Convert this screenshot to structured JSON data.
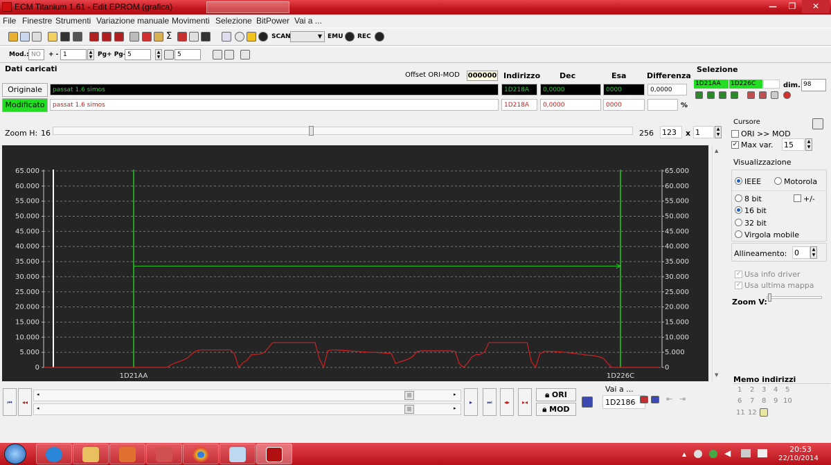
{
  "window": {
    "title": "ECM Titanium 1.61 - Edit EPROM (grafica)",
    "ghost_tabs": [
      "",
      ""
    ],
    "controls": {
      "minimize": "—",
      "restore": "❐",
      "close": "✕"
    }
  },
  "menu": [
    "File",
    "Finestre",
    "Strumenti",
    "Variazione manuale",
    "Movimenti",
    "Selezione",
    "BitPower",
    "Vai a ..."
  ],
  "toolbar1": {
    "scan_label": "SCAN",
    "emu_label": "EMU",
    "rec_label": "REC"
  },
  "toolbar2": {
    "mod_label": "Mod.:",
    "mod_value": "NO",
    "plusminus_label": "+ -",
    "plusminus_value": "1",
    "pg_label": "Pg+ Pg-",
    "pg_value": "5",
    "cols_value": "5"
  },
  "dati": {
    "section_label": "Dati caricati",
    "offset_label": "Offset ORI-MOD",
    "offset_value": "000000",
    "col_indirizzo": "Indirizzo",
    "col_dec": "Dec",
    "col_esa": "Esa",
    "col_differenza": "Differenza",
    "originale_button": "Originale",
    "modificato_button": "Modificato",
    "orig_name": "passat 1.6 simos",
    "mod_name": "passat 1.6 simos",
    "orig_indirizzo": "1D218A",
    "orig_dec": "0,0000",
    "orig_esa": "0000",
    "orig_diff": "0,0000",
    "mod_indirizzo": "1D218A",
    "mod_dec": "0,0000",
    "mod_esa": "0000",
    "mod_diff": "",
    "percent": "%"
  },
  "selezione": {
    "label": "Selezione",
    "start": "1D21AA",
    "end": "1D226C",
    "dim_label": "dim.",
    "dim_value": "98"
  },
  "zoom_h": {
    "label": "Zoom H:",
    "min": "16",
    "max": "256",
    "value": "123",
    "times": "x",
    "multiplier": "1",
    "slider_fraction": 0.445
  },
  "cursore": {
    "label": "Cursore",
    "ori_mod_label": "ORI >> MOD",
    "ori_mod_checked": false,
    "maxvar_label": "Max var.",
    "maxvar_checked": true,
    "maxvar_value": "15"
  },
  "visualizzazione": {
    "label": "Visualizzazione",
    "ieee": "IEEE",
    "motorola": "Motorola",
    "bit8": "8 bit",
    "bit16": "16 bit",
    "bit32": "32 bit",
    "virgola": "Virgola mobile",
    "plusminus": "+/-",
    "allineamento_label": "Allineamento:",
    "allineamento_value": "0",
    "usa_info": "Usa info driver",
    "usa_mappa": "Usa ultima mappa",
    "zoom_v": "Zoom V:"
  },
  "memo": {
    "label": "Memo indirizzi",
    "numbers": [
      "1",
      "2",
      "3",
      "4",
      "5",
      "6",
      "7",
      "8",
      "9",
      "10",
      "11",
      "12"
    ]
  },
  "bottom": {
    "ori_button": "ORI",
    "mod_button": "MOD",
    "vai_label": "Vai a ...",
    "vai_value": "1D2186"
  },
  "taskbar": {
    "time": "20:53",
    "date": "22/10/2014"
  },
  "colors": {
    "chart_bg": "#252525",
    "series_ori": "#d42020",
    "marker": "#22cc22",
    "selection_green": "#22dd22",
    "titlebar_red": "#c1151c"
  },
  "chart_data": {
    "type": "line",
    "y_ticks": [
      "65.000",
      "60.000",
      "55.000",
      "50.000",
      "45.000",
      "40.000",
      "35.000",
      "30.000",
      "25.000",
      "20.000",
      "15.000",
      "10.000",
      "5.000",
      "0"
    ],
    "ylim": [
      0,
      65000
    ],
    "x_labels": [
      "1D21AA",
      "1D226C"
    ],
    "cursor_value": 33500,
    "grid": true,
    "series": [
      {
        "values": [
          0,
          0,
          0,
          0,
          0,
          0,
          0,
          0,
          0,
          0,
          0,
          0,
          0,
          0,
          0,
          0,
          0,
          0,
          0,
          0,
          0,
          0,
          0,
          0,
          0,
          0,
          0,
          0,
          0,
          0,
          800,
          1500,
          2000,
          2500,
          3200,
          4500,
          5500,
          5800,
          5800,
          5800,
          5800,
          5800,
          5800,
          5800,
          5800,
          4500,
          0,
          1500,
          2500,
          4200,
          4300,
          4400,
          5000,
          6500,
          8200,
          8200,
          8200,
          8200,
          8200,
          8200,
          8200,
          8200,
          8200,
          8200,
          8200,
          3000,
          0,
          5500,
          5800,
          5800,
          5700,
          5600,
          5500,
          5400,
          5300,
          5200,
          5100,
          5000,
          5000,
          4900,
          4800,
          4700,
          4600,
          1300,
          1800,
          2300,
          2800,
          3600,
          5200,
          5500,
          5500,
          5500,
          5500,
          5500,
          5500,
          5500,
          5500,
          5300,
          1300,
          0,
          1500,
          3500,
          4200,
          4300,
          5200,
          8200,
          8200,
          8200,
          8200,
          8200,
          8200,
          8200,
          8200,
          8200,
          8200,
          2000,
          0,
          4500,
          5300,
          5300,
          5300,
          5200,
          5100,
          5000,
          4800,
          4700,
          4500,
          4300,
          4100,
          4000,
          3800,
          3500,
          3000,
          1300,
          0,
          0,
          0,
          0,
          0,
          0,
          0,
          0,
          0,
          0,
          0,
          0
        ]
      }
    ]
  }
}
